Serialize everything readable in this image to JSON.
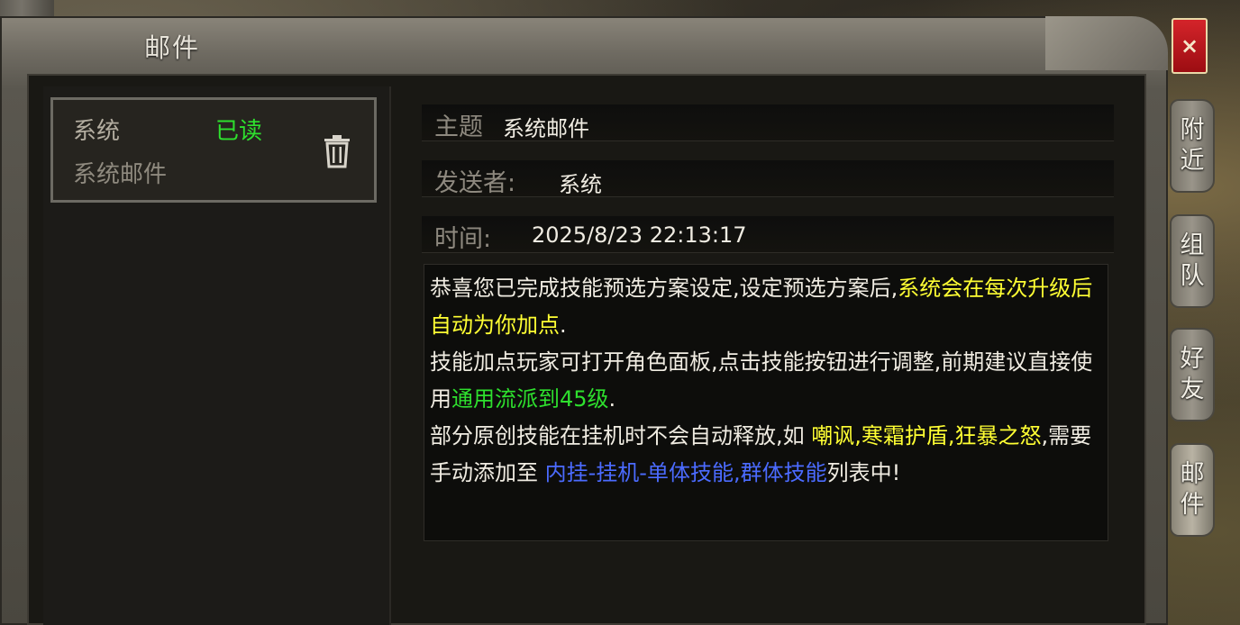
{
  "window": {
    "title": "邮件",
    "close_label": "×"
  },
  "mail_list": [
    {
      "sender": "系统",
      "status": "已读",
      "subject": "系统邮件"
    }
  ],
  "detail": {
    "subject_label": "主题",
    "subject_value": "系统邮件",
    "sender_label": "发送者:",
    "sender_value": "系统",
    "time_label": "时间:",
    "time_value": "2025/8/23 22:13:17",
    "body": {
      "p1_a": "恭喜您已完成技能预选方案设定,设定预选方案后,",
      "p1_b": "系统会在每次升级后自动为你加点",
      "p1_c": ".",
      "p2_a": "技能加点玩家可打开角色面板,点击技能按钮进行调整,前期建议直接使用",
      "p2_b": "通用流派到45级",
      "p2_c": ".",
      "p3_a": "部分原创技能在挂机时不会自动释放,如 ",
      "p3_b": "嘲讽,寒霜护盾,狂暴之怒",
      "p3_c": ",需要手动添加至 ",
      "p3_d": "内挂-挂机-单体技能,群体技能",
      "p3_e": "列表中!"
    }
  },
  "side_tabs": [
    {
      "label_1": "附",
      "label_2": "近"
    },
    {
      "label_1": "组",
      "label_2": "队"
    },
    {
      "label_1": "好",
      "label_2": "友"
    },
    {
      "label_1": "邮",
      "label_2": "件"
    }
  ],
  "colors": {
    "highlight_yellow": "#ffff33",
    "highlight_green": "#2ee02e",
    "highlight_blue": "#4b6bff",
    "close_red": "#d4242a"
  }
}
